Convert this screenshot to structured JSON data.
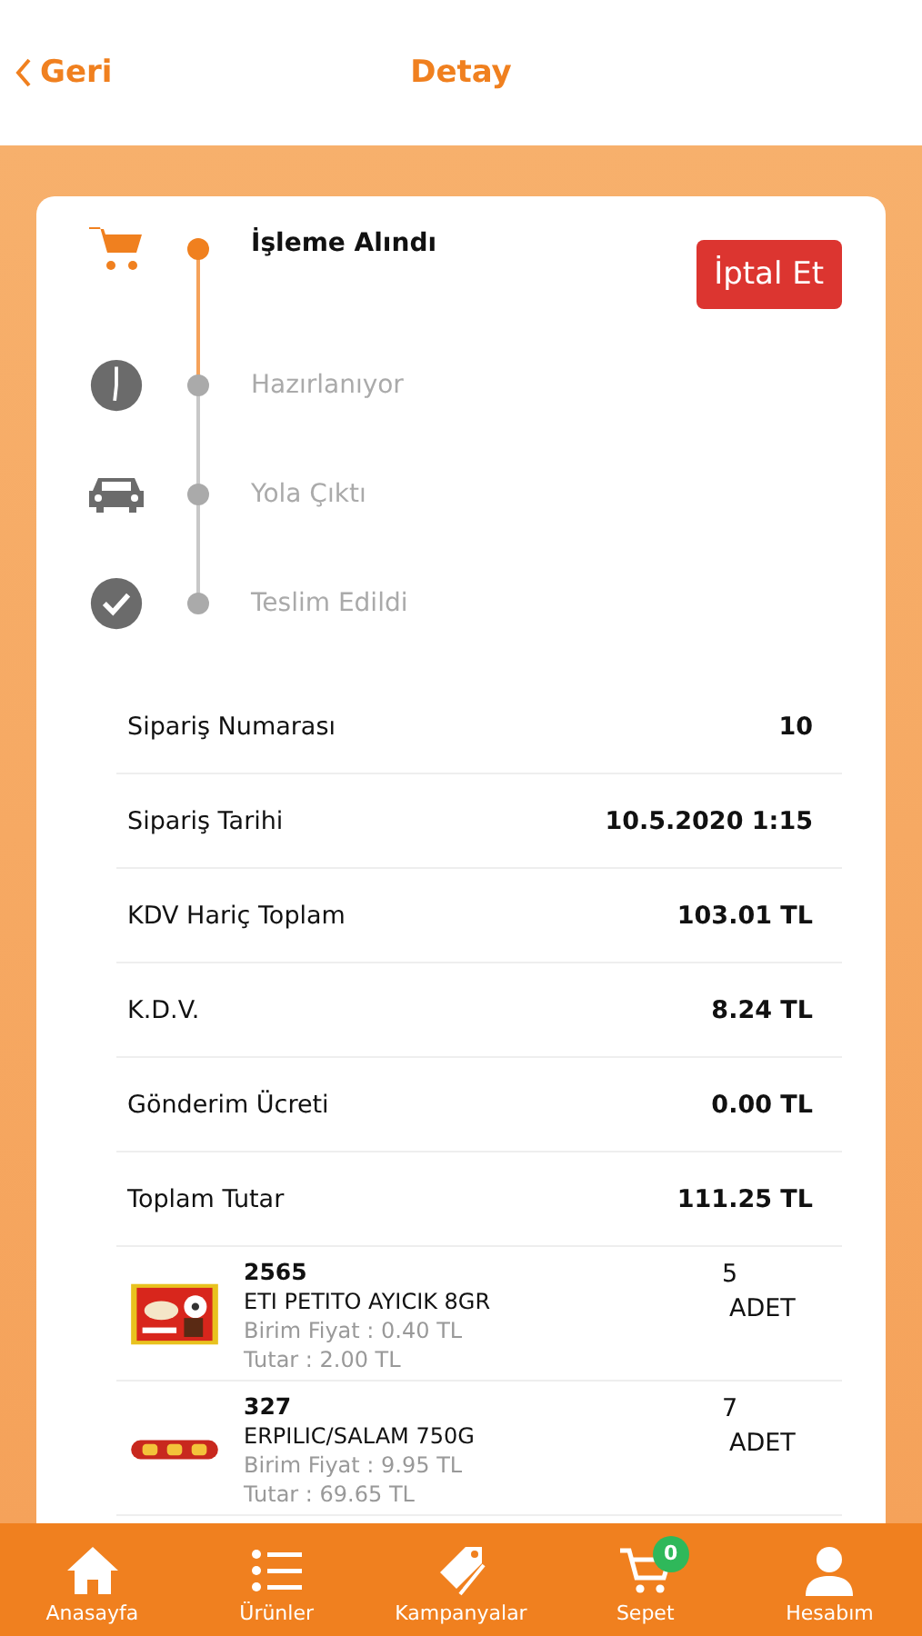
{
  "header": {
    "back": "Geri",
    "title": "Detay"
  },
  "steps": [
    {
      "label": "İşleme Alındı",
      "kind": "cart",
      "active": true
    },
    {
      "label": "Hazırlanıyor",
      "kind": "clock",
      "active": false
    },
    {
      "label": "Yola Çıktı",
      "kind": "car",
      "active": false
    },
    {
      "label": "Teslim Edildi",
      "kind": "check",
      "active": false
    }
  ],
  "cancel_button": "İptal Et",
  "summary": [
    {
      "label": "Sipariş Numarası",
      "value": "10"
    },
    {
      "label": "Sipariş Tarihi",
      "value": "10.5.2020 1:15"
    },
    {
      "label": "KDV Hariç Toplam",
      "value": "103.01 TL"
    },
    {
      "label": "K.D.V.",
      "value": "8.24 TL"
    },
    {
      "label": "Gönderim Ücreti",
      "value": "0.00 TL"
    },
    {
      "label": "Toplam Tutar",
      "value": "111.25 TL"
    }
  ],
  "items": [
    {
      "kind": "picture",
      "code": "2565",
      "name": "ETI PETITO AYICIK 8GR",
      "unit_price": "Birim Fiyat : 0.40 TL",
      "total": "Tutar : 2.00 TL",
      "quantity": "5",
      "unit": "ADET"
    },
    {
      "kind": "picture",
      "code": "327",
      "name": "ERPILIC/SALAM 750G",
      "unit_price": "Birim Fiyat : 9.95 TL",
      "total": "Tutar : 69.65 TL",
      "quantity": "7",
      "unit": "ADET"
    }
  ],
  "tab_bar": [
    {
      "label": "Anasayfa",
      "kind": "home"
    },
    {
      "label": "Ürünler",
      "kind": "list"
    },
    {
      "label": "Kampanyalar",
      "kind": "tag"
    },
    {
      "label": "Sepet",
      "kind": "cart",
      "badge": "0"
    },
    {
      "label": "Hesabım",
      "kind": "person"
    }
  ]
}
